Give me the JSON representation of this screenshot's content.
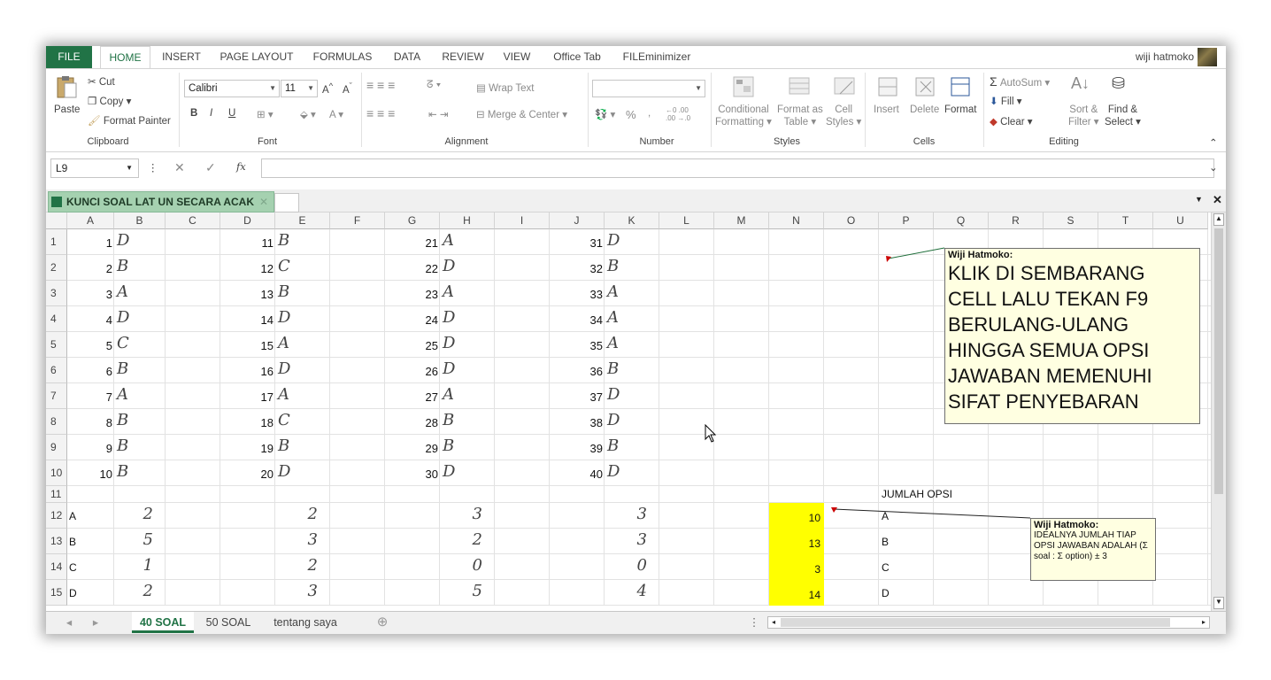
{
  "ribbon_tabs": [
    "FILE",
    "HOME",
    "INSERT",
    "PAGE LAYOUT",
    "FORMULAS",
    "DATA",
    "REVIEW",
    "VIEW",
    "Office Tab",
    "FILEminimizer"
  ],
  "user_name": "wiji hatmoko",
  "clipboard": {
    "paste": "Paste",
    "cut": "Cut",
    "copy": "Copy",
    "format_painter": "Format Painter",
    "label": "Clipboard"
  },
  "font": {
    "name": "Calibri",
    "size": "11",
    "bold": "B",
    "italic": "I",
    "underline": "U",
    "label": "Font"
  },
  "alignment": {
    "wrap": "Wrap Text",
    "merge": "Merge & Center",
    "label": "Alignment"
  },
  "number": {
    "percent": "%",
    "comma": ",",
    "inc_dec": ".00 →.0",
    "label": "Number"
  },
  "styles": {
    "conditional": "Conditional",
    "conditional2": "Formatting",
    "format_as": "Format as",
    "format_as2": "Table",
    "cell": "Cell",
    "cell2": "Styles",
    "label": "Styles"
  },
  "cells": {
    "insert": "Insert",
    "delete": "Delete",
    "format": "Format",
    "label": "Cells"
  },
  "editing": {
    "autosum": "AutoSum",
    "fill": "Fill",
    "clear": "Clear",
    "sort": "Sort &",
    "sort2": "Filter",
    "find": "Find &",
    "find2": "Select",
    "label": "Editing"
  },
  "name_box": "L9",
  "fx_label": "fx",
  "formula_value": "",
  "document_tab": "KUNCI SOAL LAT UN SECARA ACAK",
  "columns": [
    "A",
    "B",
    "C",
    "D",
    "E",
    "F",
    "G",
    "H",
    "I",
    "J",
    "K",
    "L",
    "M",
    "N",
    "O",
    "P",
    "Q",
    "R",
    "S",
    "T",
    "U"
  ],
  "answers": {
    "col1": [
      [
        "1",
        "D"
      ],
      [
        "2",
        "B"
      ],
      [
        "3",
        "A"
      ],
      [
        "4",
        "D"
      ],
      [
        "5",
        "C"
      ],
      [
        "6",
        "B"
      ],
      [
        "7",
        "A"
      ],
      [
        "8",
        "B"
      ],
      [
        "9",
        "B"
      ],
      [
        "10",
        "B"
      ]
    ],
    "col2": [
      [
        "11",
        "B"
      ],
      [
        "12",
        "C"
      ],
      [
        "13",
        "B"
      ],
      [
        "14",
        "D"
      ],
      [
        "15",
        "A"
      ],
      [
        "16",
        "D"
      ],
      [
        "17",
        "A"
      ],
      [
        "18",
        "C"
      ],
      [
        "19",
        "B"
      ],
      [
        "20",
        "D"
      ]
    ],
    "col3": [
      [
        "21",
        "A"
      ],
      [
        "22",
        "D"
      ],
      [
        "23",
        "A"
      ],
      [
        "24",
        "D"
      ],
      [
        "25",
        "D"
      ],
      [
        "26",
        "D"
      ],
      [
        "27",
        "A"
      ],
      [
        "28",
        "B"
      ],
      [
        "29",
        "B"
      ],
      [
        "30",
        "D"
      ]
    ],
    "col4": [
      [
        "31",
        "D"
      ],
      [
        "32",
        "B"
      ],
      [
        "33",
        "A"
      ],
      [
        "34",
        "A"
      ],
      [
        "35",
        "A"
      ],
      [
        "36",
        "B"
      ],
      [
        "37",
        "D"
      ],
      [
        "38",
        "D"
      ],
      [
        "39",
        "B"
      ],
      [
        "40",
        "D"
      ]
    ]
  },
  "count_header": "JUMLAH OPSI",
  "count_rows": [
    {
      "opt": "A",
      "c1": "2",
      "c2": "2",
      "c3": "3",
      "c4": "3",
      "total": "10",
      "opt2": "A"
    },
    {
      "opt": "B",
      "c1": "5",
      "c2": "3",
      "c3": "2",
      "c4": "3",
      "total": "13",
      "opt2": "B"
    },
    {
      "opt": "C",
      "c1": "1",
      "c2": "2",
      "c3": "0",
      "c4": "0",
      "total": "3",
      "opt2": "C"
    },
    {
      "opt": "D",
      "c1": "2",
      "c2": "3",
      "c3": "5",
      "c4": "4",
      "total": "14",
      "opt2": "D"
    }
  ],
  "comment1": {
    "author": "Wiji Hatmoko:",
    "text": "KLIK DI SEMBARANG CELL LALU TEKAN F9 BERULANG-ULANG HINGGA SEMUA OPSI JAWABAN MEMENUHI SIFAT PENYEBARAN"
  },
  "comment2": {
    "author": "Wiji Hatmoko:",
    "text": "IDEALNYA JUMLAH TIAP OPSI JAWABAN ADALAH (Σ soal : Σ option) ± 3"
  },
  "sheets": [
    "40 SOAL",
    "50 SOAL",
    "tentang saya"
  ],
  "accent_color": "#217346",
  "highlight_color": "#ffff00"
}
